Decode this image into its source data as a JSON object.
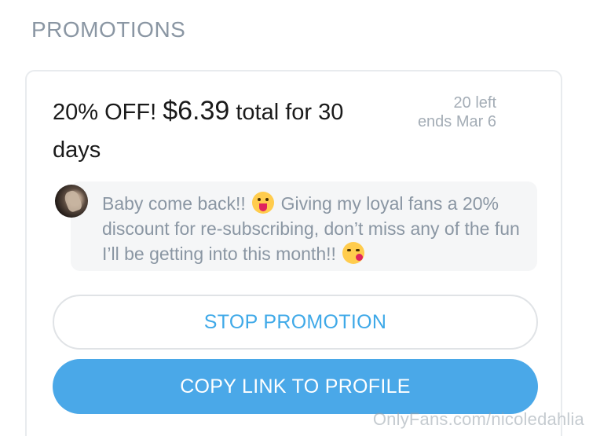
{
  "section": {
    "title": "PROMOTIONS"
  },
  "promo": {
    "discount": "20% OFF!",
    "price": "$6.39",
    "duration_text": "total for 30 days",
    "left": "20 left",
    "ends": "ends Mar 6",
    "message_part1": "Baby come back!!",
    "message_part2": "Giving my loyal fans a 20% discount for re-subscribing, don’t miss any of the fun I’ll be getting into this month!!",
    "emoji_1": "face-with-tongue-emoji",
    "emoji_2": "face-blowing-kiss-emoji"
  },
  "buttons": {
    "stop_label": "STOP PROMOTION",
    "copy_label": "COPY LINK TO PROFILE"
  },
  "watermark": "OnlyFans.com/nicoledahlia",
  "colors": {
    "accent": "#4aa8e8",
    "link_text": "#3fa9e8",
    "muted_text": "#8a96a3"
  }
}
